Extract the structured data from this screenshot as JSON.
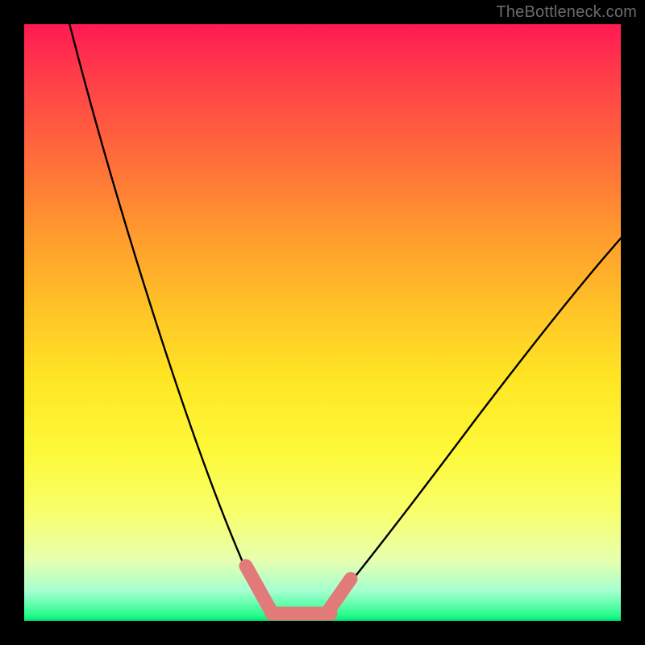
{
  "watermark": "TheBottleneck.com",
  "chart_data": {
    "type": "line",
    "title": "",
    "xlabel": "",
    "ylabel": "",
    "xlim": [
      0,
      100
    ],
    "ylim": [
      0,
      100
    ],
    "x": [
      0,
      5,
      10,
      15,
      20,
      25,
      30,
      35,
      38,
      40,
      42,
      45,
      48,
      50,
      55,
      60,
      65,
      70,
      75,
      80,
      85,
      90,
      95,
      100
    ],
    "series": [
      {
        "name": "bottleneck-curve",
        "values": [
          100,
          86,
          72,
          59,
          47,
          36,
          26,
          16,
          9,
          5,
          2,
          0,
          0,
          0,
          5,
          12,
          20,
          27,
          34,
          41,
          47,
          53,
          59,
          65
        ]
      }
    ],
    "markers": [
      {
        "name": "left-marker",
        "cx": 38,
        "cy": 9,
        "r": 2.5,
        "color": "#e27a7a"
      },
      {
        "name": "bottom-marker",
        "cx": 46,
        "cy": 0,
        "r": 2.5,
        "color": "#e27a7a"
      },
      {
        "name": "right-marker",
        "cx": 53,
        "cy": 3,
        "r": 2.5,
        "color": "#e27a7a"
      }
    ],
    "background_gradient_stops": [
      {
        "pos": 0,
        "color": "#ff1a53"
      },
      {
        "pos": 50,
        "color": "#ffe724"
      },
      {
        "pos": 95,
        "color": "#a5ffd0"
      },
      {
        "pos": 100,
        "color": "#00e676"
      }
    ]
  }
}
